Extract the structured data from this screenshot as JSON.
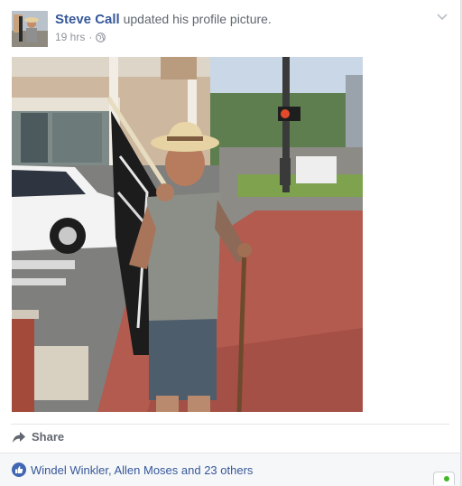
{
  "post": {
    "author": "Steve Call",
    "action": " updated his profile picture.",
    "time": "19 hrs",
    "separator": " · "
  },
  "icons": {
    "globe": "globe-icon",
    "chevron": "chevron-down-icon",
    "share": "share-arrow-icon",
    "like": "thumbs-up-icon"
  },
  "actions": {
    "share_label": "Share"
  },
  "reactions": {
    "summary": "Windel Winkler, Allen Moses and 23 others"
  },
  "colors": {
    "link": "#365899",
    "meta": "#90949c",
    "like_badge": "#4267b2",
    "online": "#42b72a"
  }
}
